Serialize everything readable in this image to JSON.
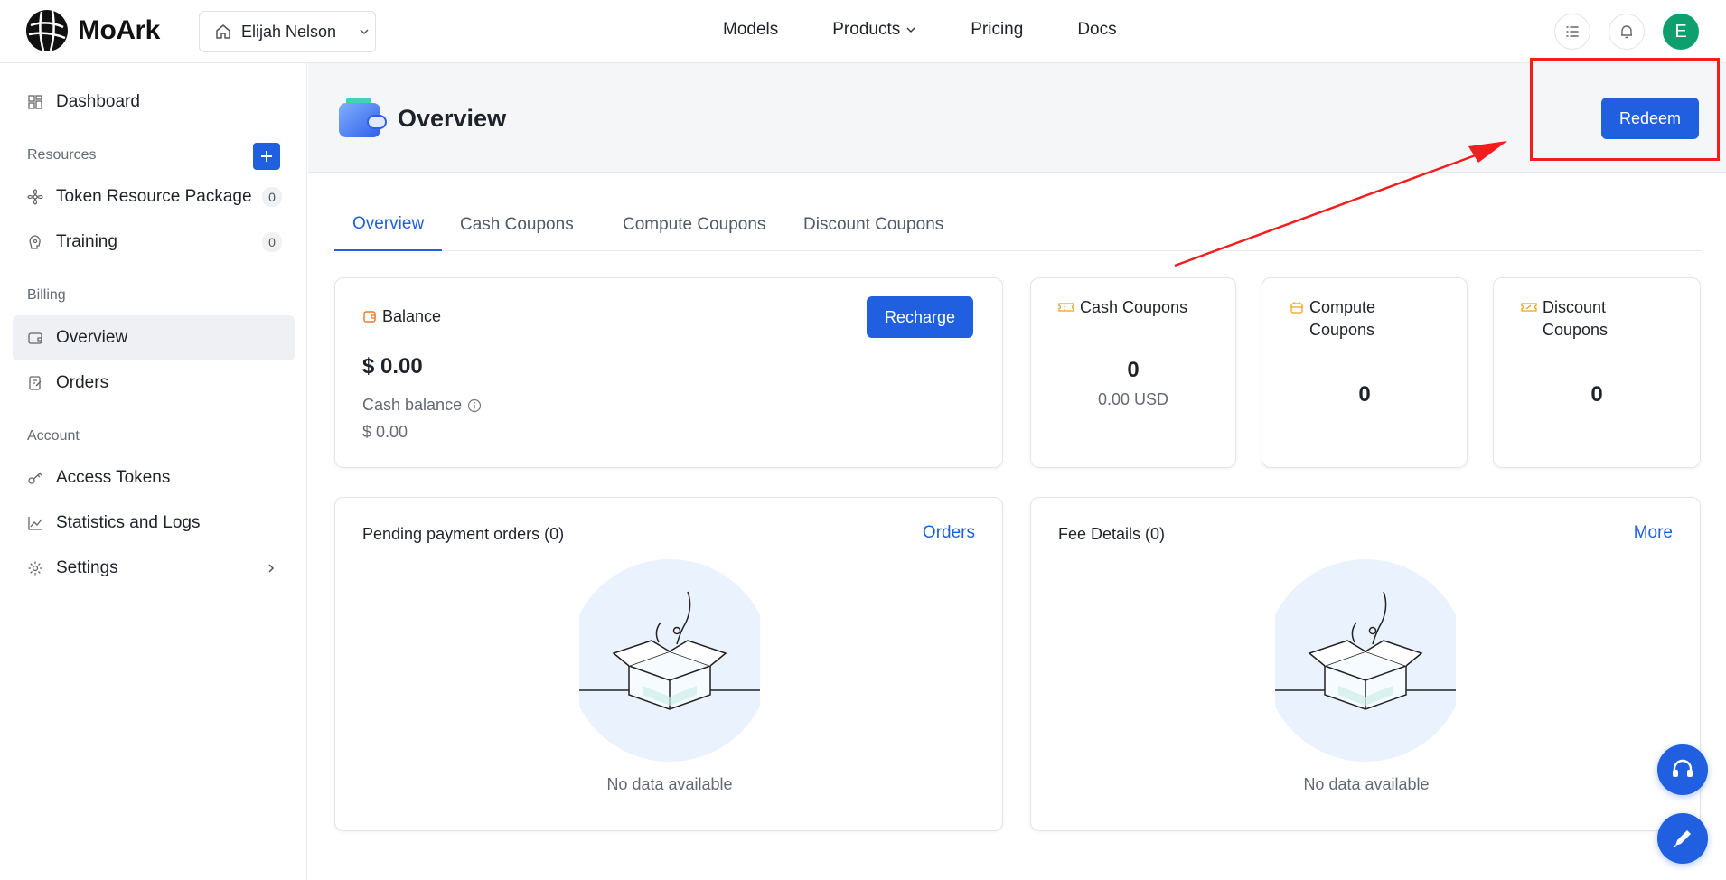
{
  "brand": {
    "name": "MoArk"
  },
  "workspace": {
    "name": "Elijah Nelson"
  },
  "topnav": {
    "models": "Models",
    "products": "Products",
    "pricing": "Pricing",
    "docs": "Docs"
  },
  "user": {
    "avatar_initial": "E"
  },
  "sidebar": {
    "dashboard": "Dashboard",
    "resources_section": "Resources",
    "token_package": {
      "label": "Token Resource Package",
      "count": "0"
    },
    "training": {
      "label": "Training",
      "count": "0"
    },
    "billing_section": "Billing",
    "overview": "Overview",
    "orders": "Orders",
    "account_section": "Account",
    "access_tokens": "Access Tokens",
    "statistics": "Statistics and Logs",
    "settings": "Settings"
  },
  "header": {
    "title": "Overview",
    "redeem": "Redeem"
  },
  "tabs": [
    "Overview",
    "Cash Coupons",
    "Compute Coupons",
    "Discount Coupons"
  ],
  "balance": {
    "title": "Balance",
    "recharge": "Recharge",
    "amount": "$ 0.00",
    "cash_label": "Cash balance",
    "cash_value": "$ 0.00"
  },
  "cash_coupons": {
    "title": "Cash Coupons",
    "count": "0",
    "usd": "0.00 USD"
  },
  "compute_coupons": {
    "title_line1": "Compute",
    "title_line2": "Coupons",
    "count": "0"
  },
  "discount_coupons": {
    "title_line1": "Discount",
    "title_line2": "Coupons",
    "count": "0"
  },
  "pending_orders": {
    "title": "Pending payment orders (0)",
    "link": "Orders",
    "empty": "No data available"
  },
  "fee_details": {
    "title": "Fee Details (0)",
    "link": "More",
    "empty": "No data available"
  },
  "colors": {
    "primary": "#1f5fe0",
    "avatar": "#0e9f6e",
    "coupon_icon": "#f0a020",
    "annotation": "#f21e1e"
  }
}
